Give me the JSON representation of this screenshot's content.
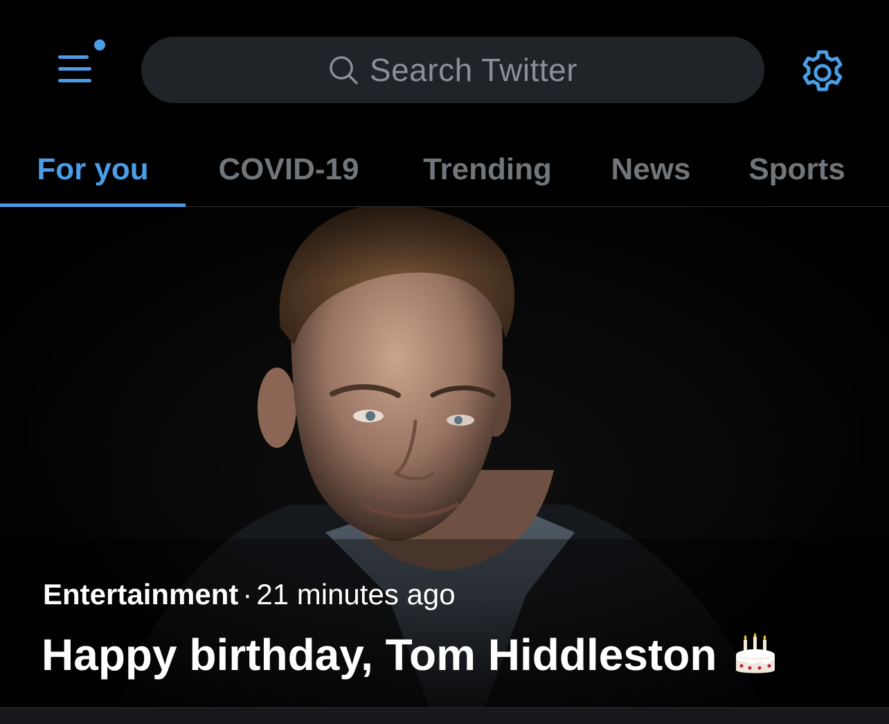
{
  "header": {
    "menu_icon": "hamburger-menu-icon",
    "notification_dot_color": "#4a9ee6",
    "search": {
      "placeholder": "Search Twitter",
      "icon": "search-icon"
    },
    "settings_icon": "gear-icon"
  },
  "tabs": [
    {
      "label": "For you",
      "active": true
    },
    {
      "label": "COVID-19",
      "active": false
    },
    {
      "label": "Trending",
      "active": false
    },
    {
      "label": "News",
      "active": false
    },
    {
      "label": "Sports",
      "active": false
    }
  ],
  "hero": {
    "category": "Entertainment",
    "separator": "·",
    "time": "21 minutes ago",
    "title": "Happy birthday, Tom Hiddleston",
    "emoji_icon": "birthday-cake-icon"
  },
  "colors": {
    "accent": "#4a9ee6",
    "background": "#000000",
    "search_bg": "#202327",
    "muted_text": "#71767b"
  }
}
